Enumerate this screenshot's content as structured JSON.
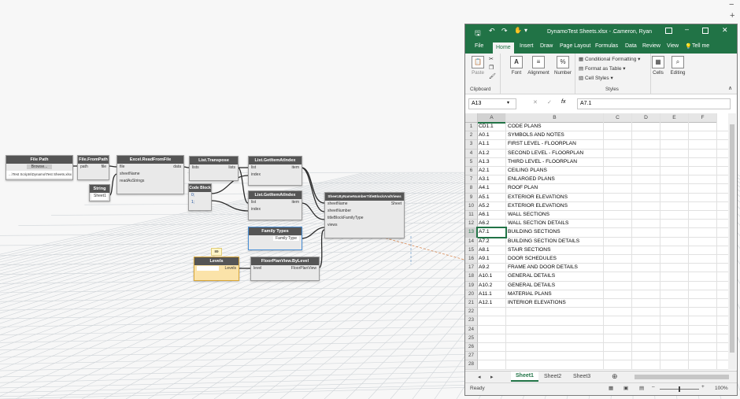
{
  "canvas": {
    "nodes": [
      {
        "title": "File Path",
        "button": "Browse...",
        "path": "...\\Test Scripts\\Dynamo\\Test Sheets.xlsx"
      },
      {
        "title": "File.FromPath",
        "in": "path",
        "out": "file"
      },
      {
        "title": "String",
        "value": "Sheet1"
      },
      {
        "title": "Excel.ReadFromFile",
        "inputs": [
          "file",
          "sheetName",
          "readAsStrings"
        ],
        "out": "data"
      },
      {
        "title": "List.Transpose",
        "in": "lists",
        "out": "lists"
      },
      {
        "title": "Code Block",
        "lines": [
          "0;",
          "1;"
        ]
      },
      {
        "title": "List.GetItemAtIndex",
        "inputs": [
          "list",
          "index"
        ],
        "out": "item"
      },
      {
        "title": "List.GetItemAtIndex",
        "inputs": [
          "list",
          "index"
        ],
        "out": "item"
      },
      {
        "title": "Sheet.ByNameNumberTitleBlockAndViews",
        "inputs": [
          "sheetName",
          "sheetNumber",
          "titleBlockFamilyType",
          "views"
        ],
        "out": "Sheet"
      },
      {
        "title": "Family Types",
        "value": "Family Type"
      },
      {
        "title": "Levels",
        "out": "Levels"
      },
      {
        "title": "FloorPlanView.ByLevel",
        "in": "level",
        "out": "FloorPlanView"
      }
    ],
    "tooltip": "89",
    "zoom_minus": "−",
    "zoom_plus": "+"
  },
  "excel": {
    "title": "DynamoTest Sheets.xlsx - ...",
    "user": "Cameron, Ryan",
    "ribbon_tabs": [
      "File",
      "Home",
      "Insert",
      "Draw",
      "Page Layout",
      "Formulas",
      "Data",
      "Review",
      "View"
    ],
    "tell_me": "Tell me",
    "groups": {
      "clipboard": "Clipboard",
      "paste": "Paste",
      "font": "Font",
      "alignment": "Alignment",
      "number": "Number",
      "cond_format": "Conditional Formatting",
      "format_table": "Format as Table",
      "cell_styles": "Cell Styles",
      "styles": "Styles",
      "cells": "Cells",
      "editing": "Editing"
    },
    "name_box": "A13",
    "formula": "A7.1",
    "columns": [
      "A",
      "B",
      "C",
      "D",
      "E",
      "F"
    ],
    "rows": [
      [
        "CD1.1",
        "CODE PLANS"
      ],
      [
        "A0.1",
        "SYMBOLS AND NOTES"
      ],
      [
        "A1.1",
        "FIRST LEVEL - FLOORPLAN"
      ],
      [
        "A1.2",
        "SECOND LEVEL - FLOORPLAN"
      ],
      [
        "A1.3",
        "THIRD LEVEL - FLOORPLAN"
      ],
      [
        "A2.1",
        "CEILING PLANS"
      ],
      [
        "A3.1",
        "ENLARGED PLANS"
      ],
      [
        "A4.1",
        "ROOF PLAN"
      ],
      [
        "A5.1",
        "EXTERIOR ELEVATIONS"
      ],
      [
        "A5.2",
        "EXTERIOR ELEVATIONS"
      ],
      [
        "A6.1",
        "WALL SECTIONS"
      ],
      [
        "A6.2",
        "WALL SECTION DETAILS"
      ],
      [
        "A7.1",
        "BUILDING SECTIONS"
      ],
      [
        "A7.2",
        "BUILDING SECTION DETAILS"
      ],
      [
        "A8.1",
        "STAIR SECTIONS"
      ],
      [
        "A9.1",
        "DOOR SCHEDULES"
      ],
      [
        "A9.2",
        "FRAME AND DOOR DETAILS"
      ],
      [
        "A10.1",
        "GENERAL DETAILS"
      ],
      [
        "A10.2",
        "GENERAL DETAILS"
      ],
      [
        "A11.1",
        "MATERIAL PLANS"
      ],
      [
        "A12.1",
        "INTERIOR ELEVATIONS"
      ],
      [
        "",
        ""
      ],
      [
        "",
        ""
      ],
      [
        "",
        ""
      ],
      [
        "",
        ""
      ],
      [
        "",
        ""
      ],
      [
        "",
        ""
      ],
      [
        "",
        ""
      ]
    ],
    "sheet_tabs": [
      "Sheet1",
      "Sheet2",
      "Sheet3"
    ],
    "status": "Ready",
    "zoom": "100%"
  }
}
